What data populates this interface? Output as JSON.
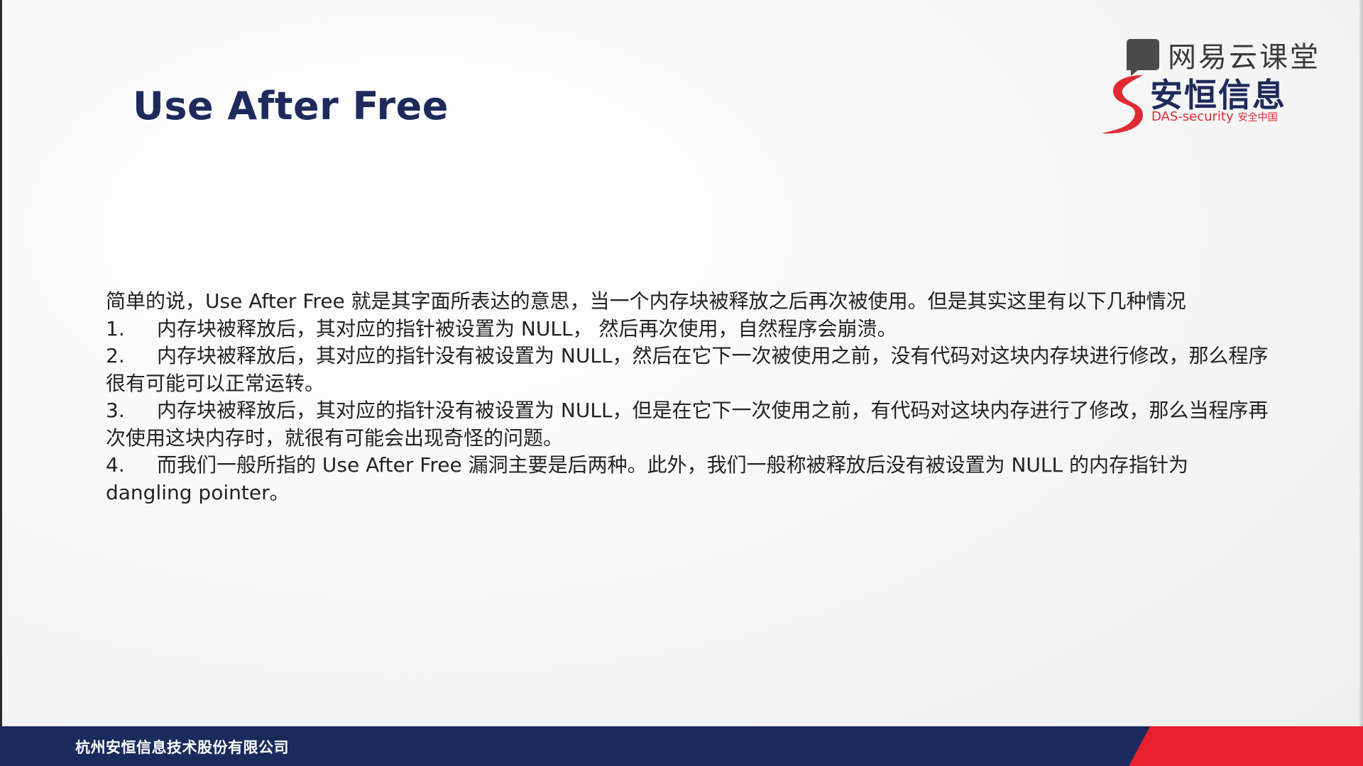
{
  "slide": {
    "title": "Use After Free",
    "intro": "简单的说，Use After Free 就是其字面所表达的意思，当一个内存块被释放之后再次被使用。但是其实这里有以下几种情况",
    "items": [
      {
        "num": "1.",
        "text": "内存块被释放后，其对应的指针被设置为 NULL， 然后再次使用，自然程序会崩溃。"
      },
      {
        "num": "2.",
        "text": "内存块被释放后，其对应的指针没有被设置为 NULL，然后在它下一次被使用之前，没有代码对这块内存块进行修改，那么程序很有可能可以正常运转。"
      },
      {
        "num": "3.",
        "text": "内存块被释放后，其对应的指针没有被设置为 NULL，但是在它下一次使用之前，有代码对这块内存进行了修改，那么当程序再次使用这块内存时，就很有可能会出现奇怪的问题。"
      },
      {
        "num": "4.",
        "text": "而我们一般所指的 Use After Free 漏洞主要是后两种。此外，我们一般称被释放后没有被设置为 NULL 的内存指针为 dangling pointer。"
      }
    ]
  },
  "logos": {
    "netease_name": "网易云课堂",
    "netease_icon": "netease-cloud-classroom-icon",
    "das_cn": "安恒信息",
    "das_en": "DAS-security",
    "das_tagline": "安全中国",
    "das_icon": "das-security-mark-icon"
  },
  "footer": {
    "company": "杭州安恒信息技术股份有限公司"
  },
  "colors": {
    "title": "#1f2a5c",
    "footer_navy": "#1b2a5c",
    "footer_red": "#e8202e",
    "brand_red": "#e02a34"
  }
}
